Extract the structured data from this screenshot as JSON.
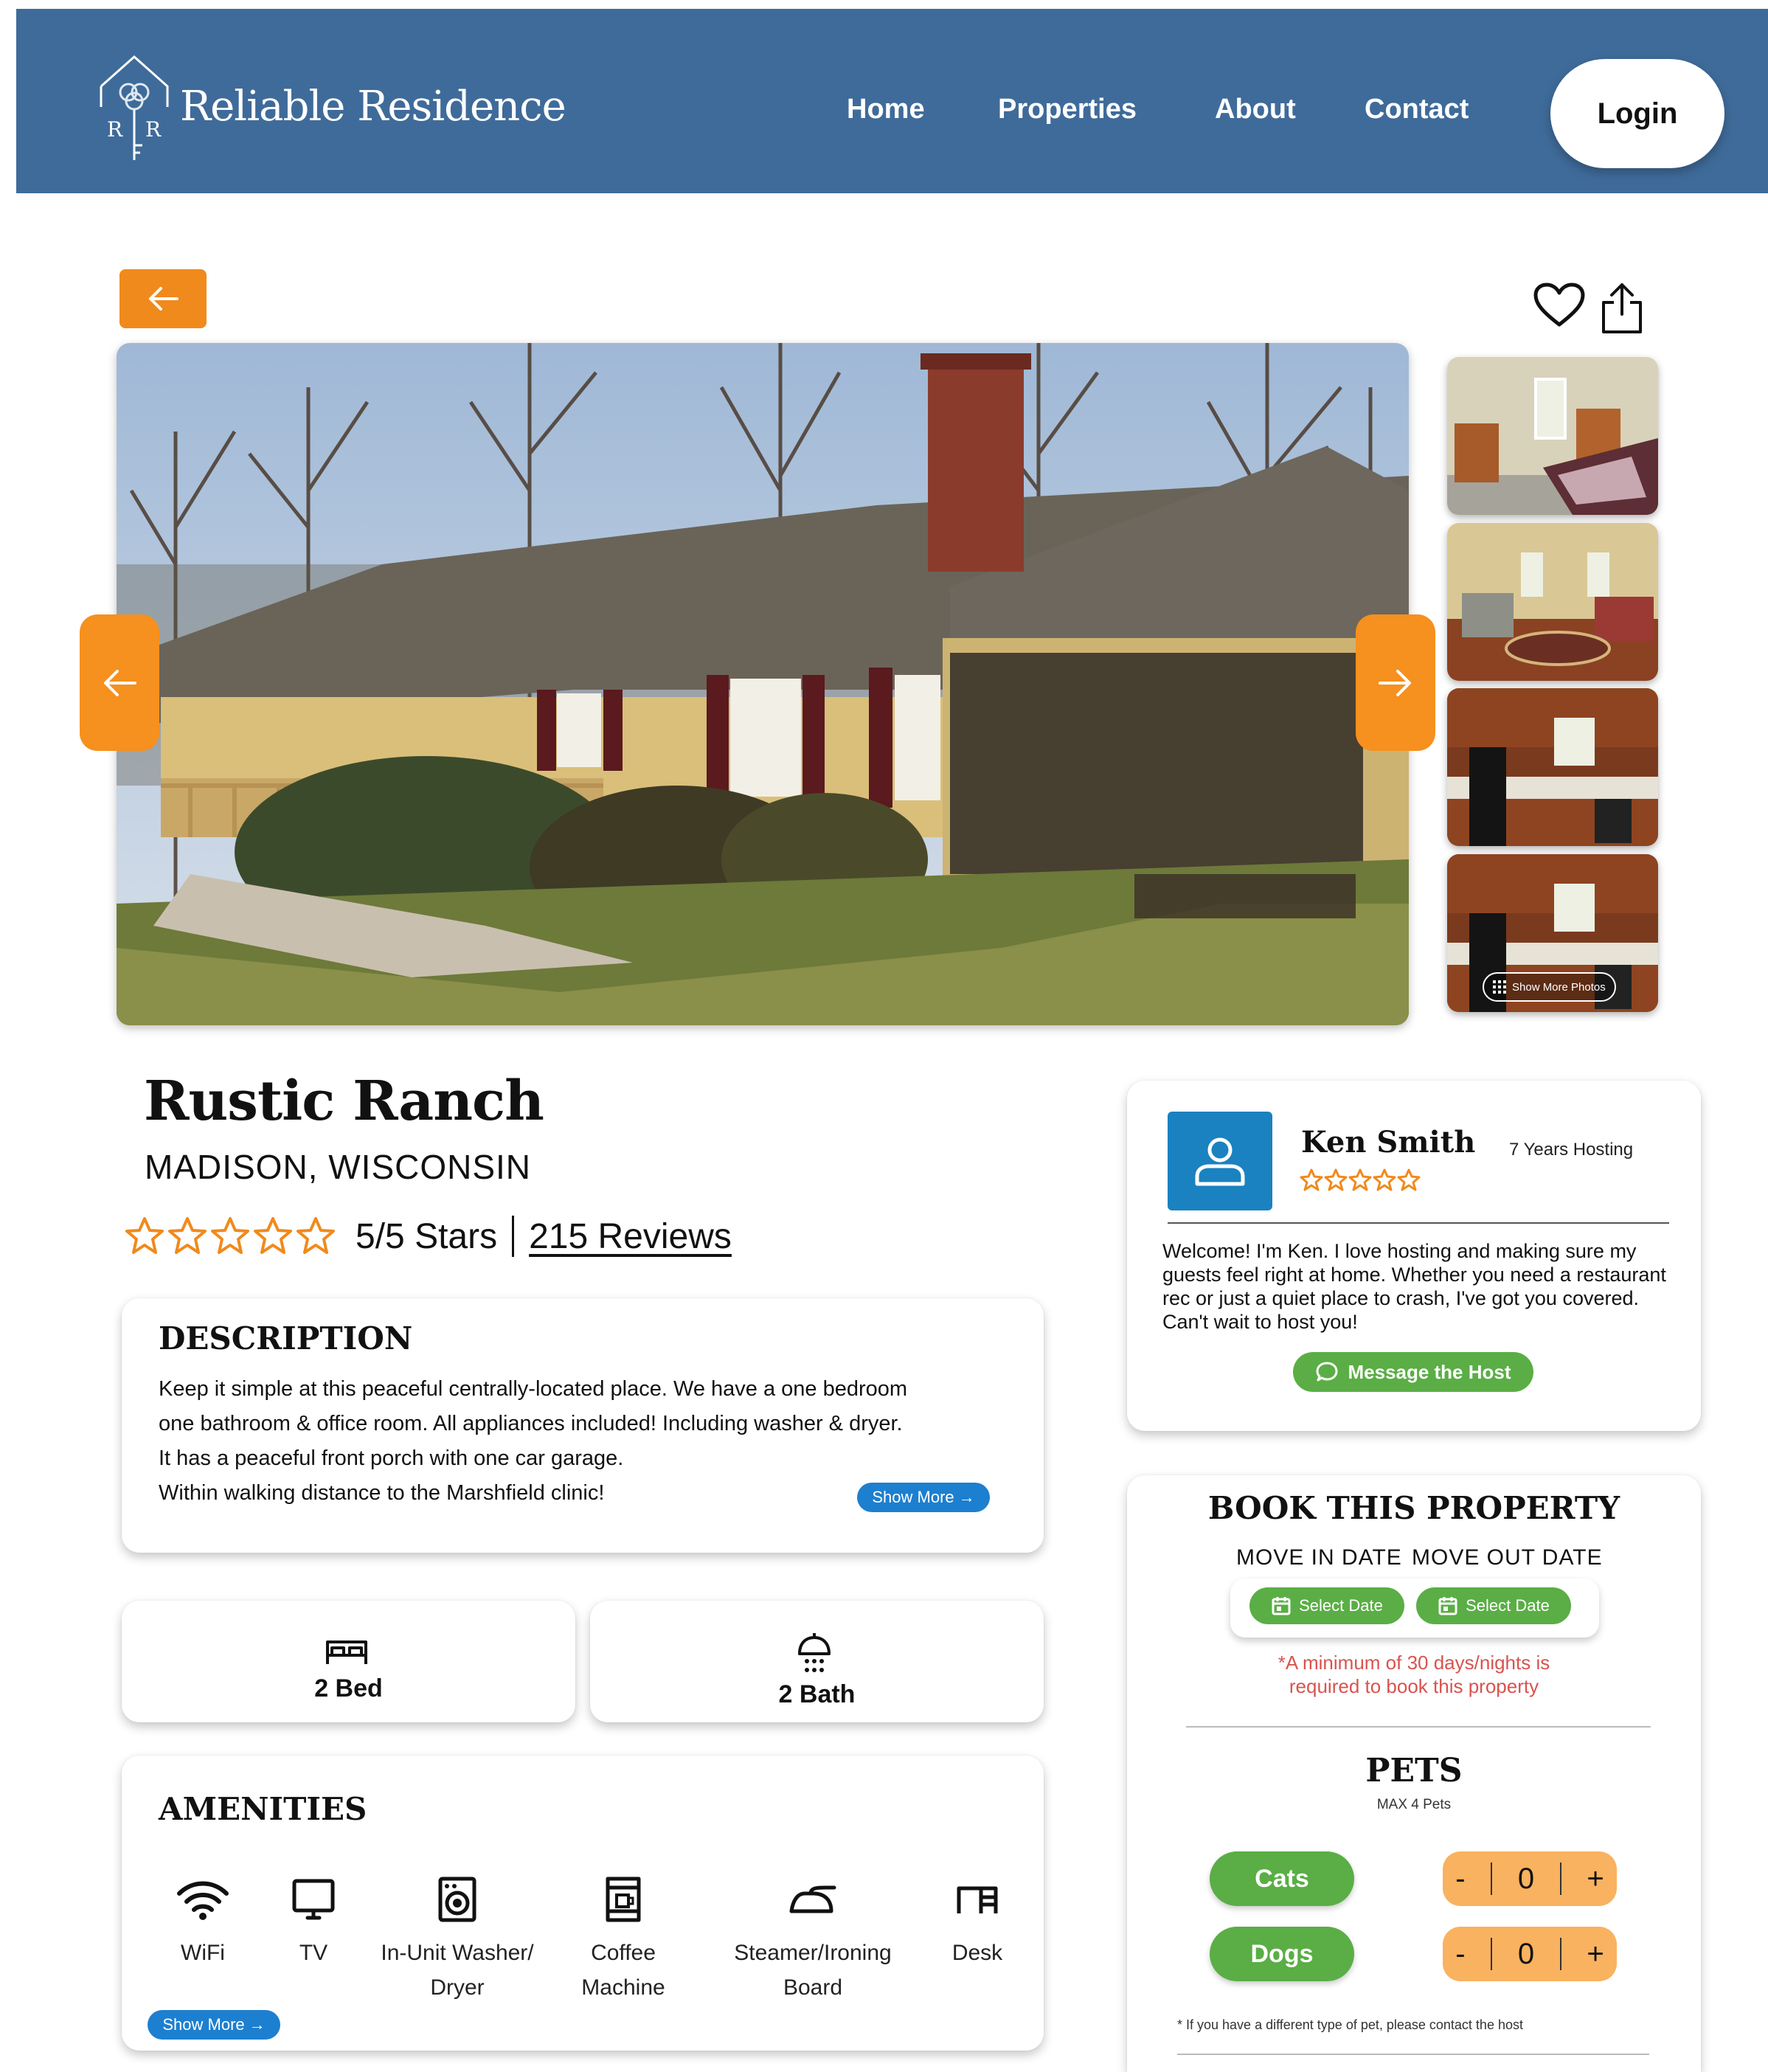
{
  "header": {
    "brand": "Reliable Residence",
    "nav": [
      "Home",
      "Properties",
      "About",
      "Contact"
    ],
    "login_label": "Login"
  },
  "gallery": {
    "show_more_photos": "Show More Photos"
  },
  "property": {
    "title": "Rustic Ranch",
    "location": "MADISON, WISCONSIN",
    "rating_text": "5/5 Stars",
    "reviews_text": "215 Reviews",
    "stars": 5
  },
  "description": {
    "heading": "DESCRIPTION",
    "lines": [
      "Keep it simple at this peaceful centrally-located place. We have a one bedroom",
      "one bathroom & office room. All appliances included! Including washer & dryer.",
      "It has a peaceful front porch with one car garage.",
      "Within walking distance to the Marshfield clinic!"
    ],
    "show_more": "Show More"
  },
  "stats": {
    "beds": "2 Bed",
    "baths": "2 Bath"
  },
  "amenities": {
    "heading": "AMENITIES",
    "items": [
      {
        "icon": "wifi-icon",
        "line1": "WiFi",
        "line2": ""
      },
      {
        "icon": "tv-icon",
        "line1": "TV",
        "line2": ""
      },
      {
        "icon": "washer-icon",
        "line1": "In-Unit Washer/",
        "line2": "Dryer"
      },
      {
        "icon": "coffee-machine-icon",
        "line1": "Coffee",
        "line2": "Machine"
      },
      {
        "icon": "iron-icon",
        "line1": "Steamer/Ironing",
        "line2": "Board"
      },
      {
        "icon": "desk-icon",
        "line1": "Desk",
        "line2": ""
      }
    ],
    "show_more": "Show More"
  },
  "host": {
    "name": "Ken Smith",
    "years": "7 Years Hosting",
    "stars": 5,
    "bio": "Welcome! I'm Ken. I love hosting and making sure my guests feel right at home. Whether you need a restaurant rec or just a quiet place to crash, I've got you covered. Can't wait to host you!",
    "message_button": "Message the Host"
  },
  "booking": {
    "heading": "BOOK THIS PROPERTY",
    "move_in_label": "MOVE IN DATE",
    "move_out_label": "MOVE OUT DATE",
    "select_date": "Select Date",
    "min_note_1": "*A minimum of 30 days/nights is",
    "min_note_2": "required to book this property",
    "pets_heading": "PETS",
    "pets_max": "MAX 4 Pets",
    "pets": [
      {
        "label": "Cats",
        "count": "0"
      },
      {
        "label": "Dogs",
        "count": "0"
      }
    ],
    "minus": "-",
    "plus": "+",
    "pet_note": "* If you have a different type of pet, please contact the host"
  },
  "colors": {
    "header_bg": "#3f6b9a",
    "accent_orange": "#f08a1c",
    "accent_green": "#5aae45",
    "accent_blue": "#1d7fcf",
    "stepper_bg": "#f9b25f",
    "warning_red": "#d9534f"
  }
}
